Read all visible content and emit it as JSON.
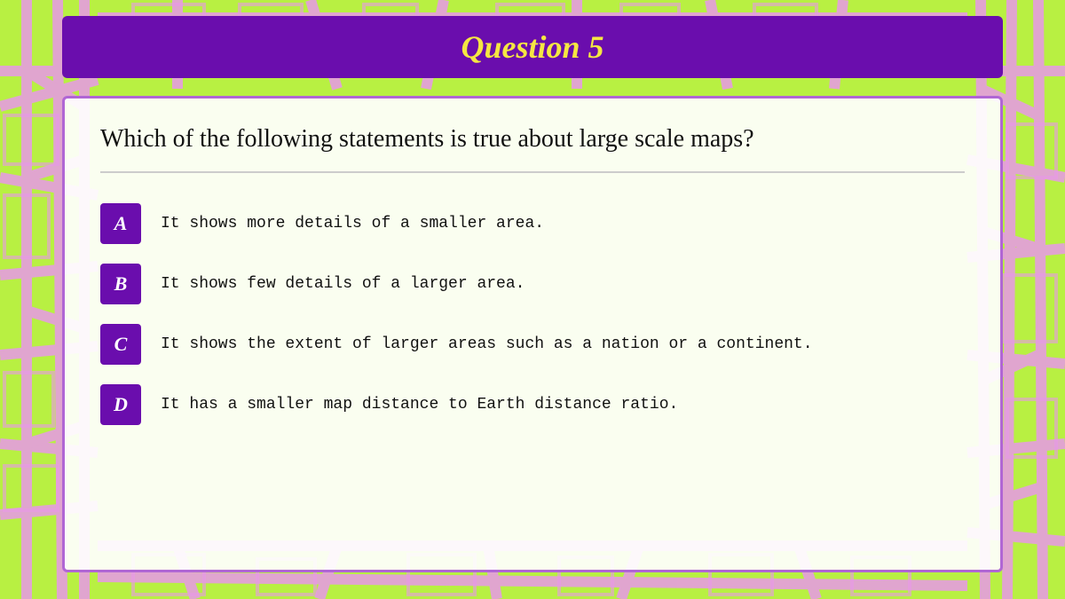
{
  "background": {
    "color": "#b8f042",
    "road_color": "#e898e8"
  },
  "title_bar": {
    "background": "#6a0dad",
    "text": "Question 5",
    "text_color": "#f5e642"
  },
  "question": {
    "text": "Which of the following statements is true about large scale maps?"
  },
  "options": [
    {
      "label": "A",
      "text": "It shows more details of a smaller area."
    },
    {
      "label": "B",
      "text": "It shows few details of a larger area."
    },
    {
      "label": "C",
      "text": "It shows the extent of larger areas such as a nation or a continent."
    },
    {
      "label": "D",
      "text": "It has a smaller map distance to Earth distance ratio."
    }
  ]
}
